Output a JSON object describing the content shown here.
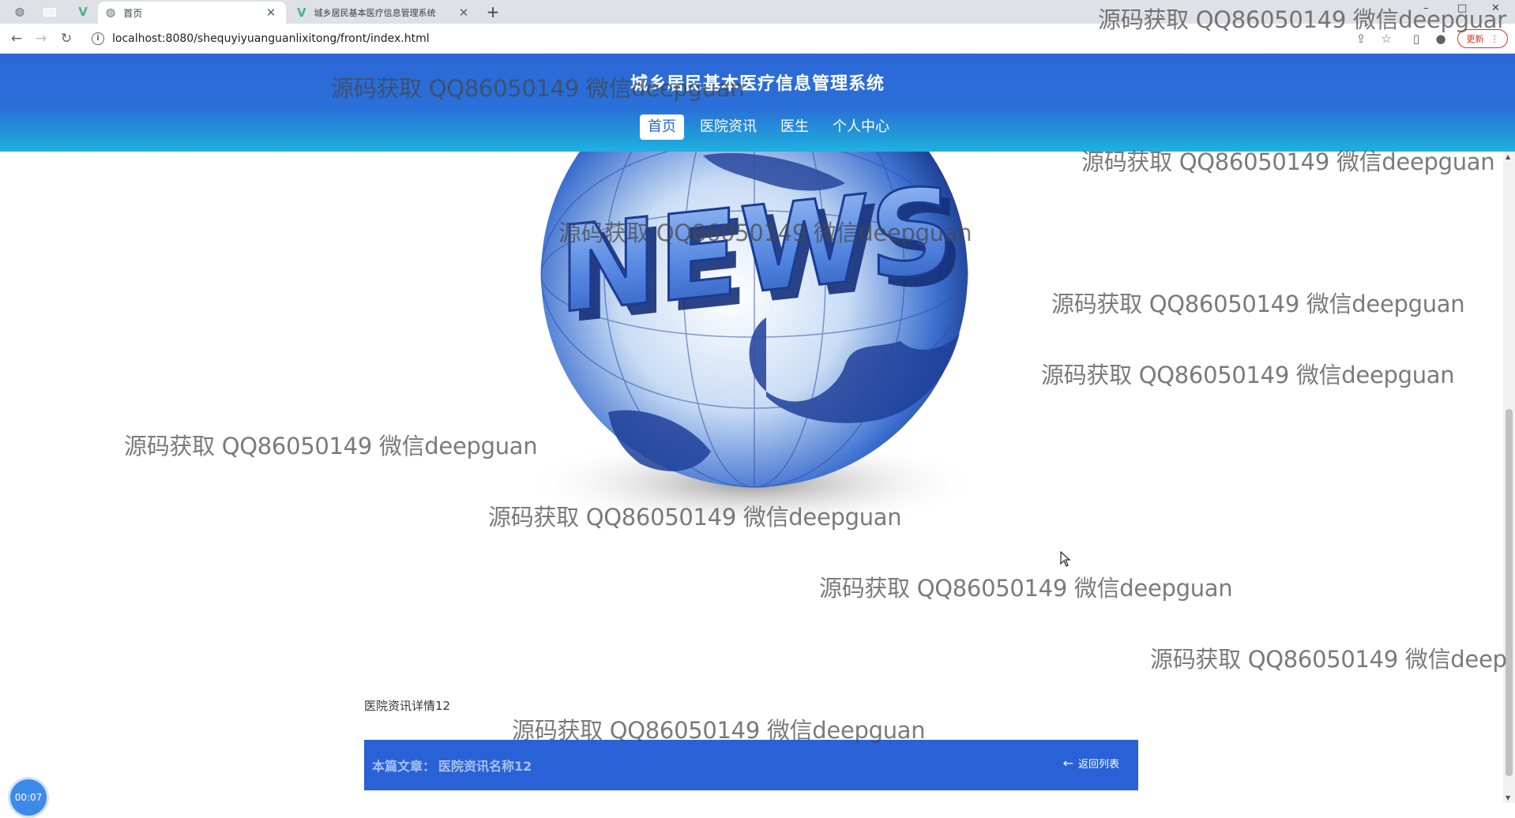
{
  "browser": {
    "tabs": [
      {
        "title": "首页",
        "active": true,
        "icon": "globe-icon"
      },
      {
        "title": "城乡居民基本医疗信息管理系统",
        "active": false,
        "icon": "vue-logo-icon"
      }
    ],
    "new_tab": "+",
    "window_controls": [
      "–",
      "□",
      "✕"
    ],
    "url": "localhost:8080/shequyiyuanguanlixitong/front/index.html",
    "update_label": "更新"
  },
  "header": {
    "title": "城乡居民基本医疗信息管理系统",
    "nav": [
      {
        "label": "首页",
        "active": true
      },
      {
        "label": "医院资讯",
        "active": false
      },
      {
        "label": "医生",
        "active": false
      },
      {
        "label": "个人中心",
        "active": false
      }
    ],
    "gradient": [
      "#2b68d6",
      "#1fb1e0"
    ]
  },
  "banner": {
    "text": "NEWS",
    "icon": "news-globe-image"
  },
  "detail": {
    "label": "医院资讯详情12",
    "article_prefix": "本篇文章：",
    "article_name": "医院资讯名称12",
    "back_label": "返回列表",
    "bar_color": "#2962d6"
  },
  "watermark": {
    "text": "源码获取 QQ86050149 微信deepguan",
    "clipped_right": "源码获取 QQ86050149 微信deep",
    "clipped_top": "源码获取 QQ86050149 微信deepguar"
  },
  "timer": "00:07"
}
